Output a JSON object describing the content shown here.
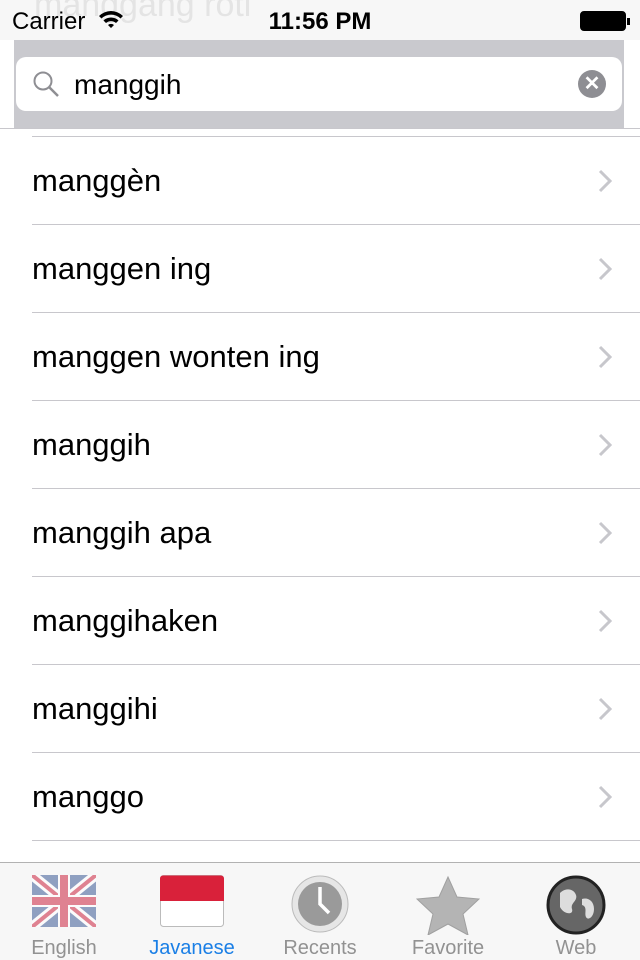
{
  "status_bar": {
    "carrier": "Carrier",
    "time": "11:56 PM",
    "ghost_text": "manggang roti"
  },
  "search": {
    "value": "manggih",
    "icon": "search-icon",
    "clear_icon": "clear-icon"
  },
  "results": [
    {
      "label": "manggèn"
    },
    {
      "label": "manggen ing"
    },
    {
      "label": "manggen wonten ing"
    },
    {
      "label": "manggih"
    },
    {
      "label": "manggih apa"
    },
    {
      "label": "manggihaken"
    },
    {
      "label": "manggihi"
    },
    {
      "label": "manggo"
    }
  ],
  "tabs": [
    {
      "label": "English",
      "icon": "uk-flag-icon",
      "active": false
    },
    {
      "label": "Javanese",
      "icon": "indonesia-flag-icon",
      "active": true
    },
    {
      "label": "Recents",
      "icon": "clock-icon",
      "active": false
    },
    {
      "label": "Favorite",
      "icon": "star-icon",
      "active": false
    },
    {
      "label": "Web",
      "icon": "globe-icon",
      "active": false
    }
  ],
  "colors": {
    "accent": "#1a7fe6",
    "search_bg": "#c9c9ce"
  }
}
